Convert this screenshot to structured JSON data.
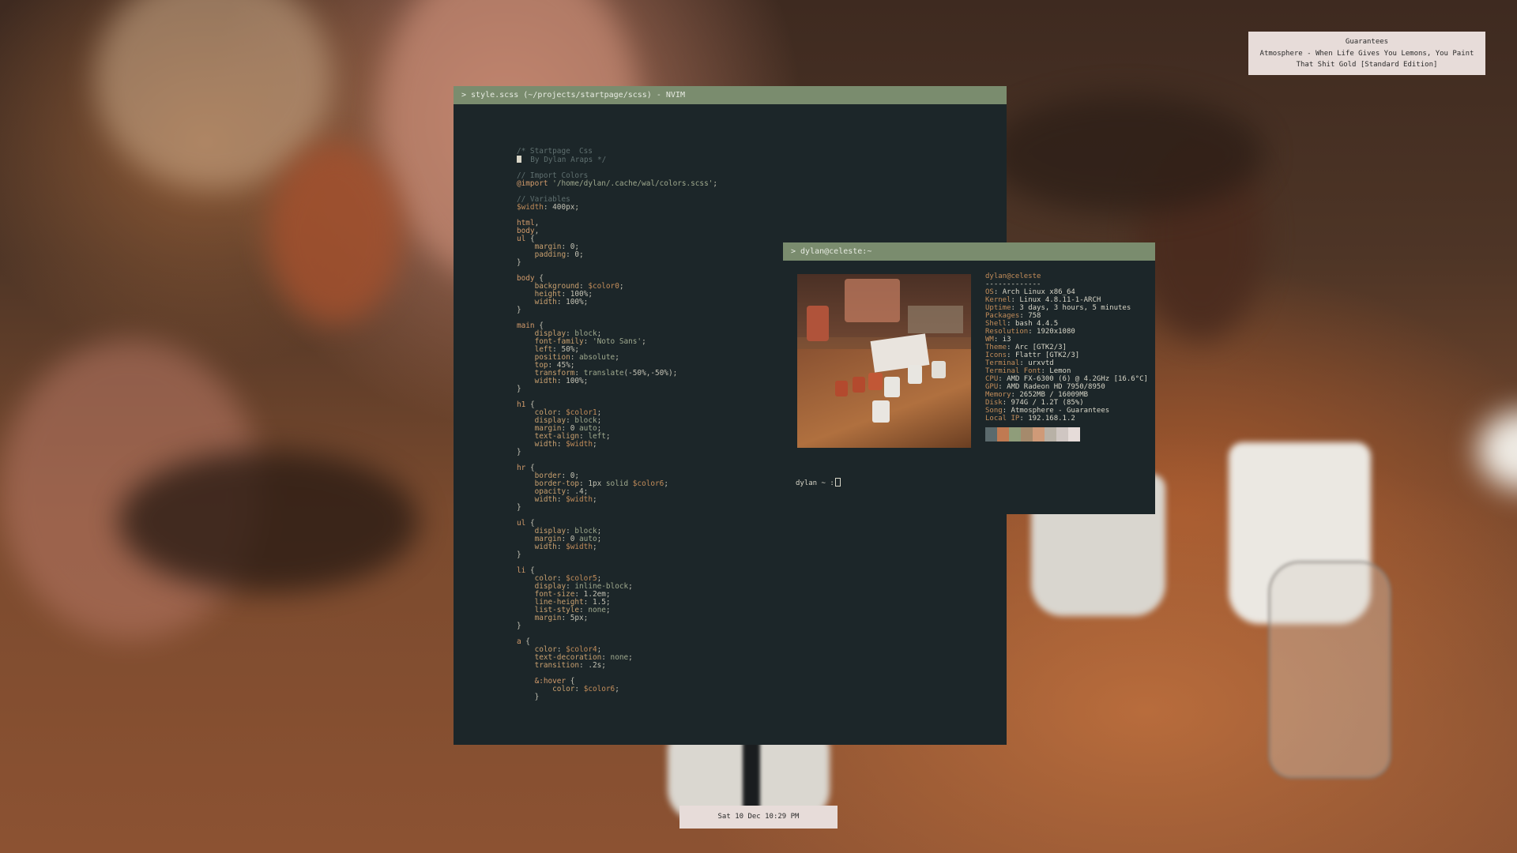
{
  "music_widget": {
    "title": "Guarantees",
    "subtitle": "Atmosphere - When Life Gives You Lemons, You Paint That Shit Gold [Standard Edition]"
  },
  "editor": {
    "title": "> style.scss (~/projects/startpage/scss) - NVIM"
  },
  "terminal": {
    "title": "> dylan@celeste:~",
    "user_host": "dylan@celeste",
    "separator": "-------------",
    "info": [
      {
        "key": "OS",
        "value": "Arch Linux x86_64"
      },
      {
        "key": "Kernel",
        "value": "Linux 4.8.11-1-ARCH"
      },
      {
        "key": "Uptime",
        "value": "3 days, 3 hours, 5 minutes"
      },
      {
        "key": "Packages",
        "value": "758"
      },
      {
        "key": "Shell",
        "value": "bash 4.4.5"
      },
      {
        "key": "Resolution",
        "value": "1920x1080"
      },
      {
        "key": "WM",
        "value": "i3"
      },
      {
        "key": "Theme",
        "value": "Arc [GTK2/3]"
      },
      {
        "key": "Icons",
        "value": "Flattr [GTK2/3]"
      },
      {
        "key": "Terminal",
        "value": "urxvtd"
      },
      {
        "key": "Terminal Font",
        "value": "Lemon"
      },
      {
        "key": "CPU",
        "value": "AMD FX-6300 (6) @ 4.2GHz [16.6°C]"
      },
      {
        "key": "GPU",
        "value": "AMD Radeon HD 7950/8950"
      },
      {
        "key": "Memory",
        "value": "2652MB / 16009MB"
      },
      {
        "key": "Disk",
        "value": "974G / 1.2T (85%)"
      },
      {
        "key": "Song",
        "value": "Atmosphere - Guarantees"
      },
      {
        "key": "Local IP",
        "value": "192.168.1.2"
      }
    ],
    "palette": [
      "#5b6a6d",
      "#c07a52",
      "#8f9d7a",
      "#a58a6c",
      "#cf9a78",
      "#b8b1a6",
      "#cfc6c2",
      "#e6dcd9"
    ],
    "prompt": "dylan ~ :"
  },
  "clock": {
    "text": "Sat 10 Dec 10:29 PM"
  }
}
